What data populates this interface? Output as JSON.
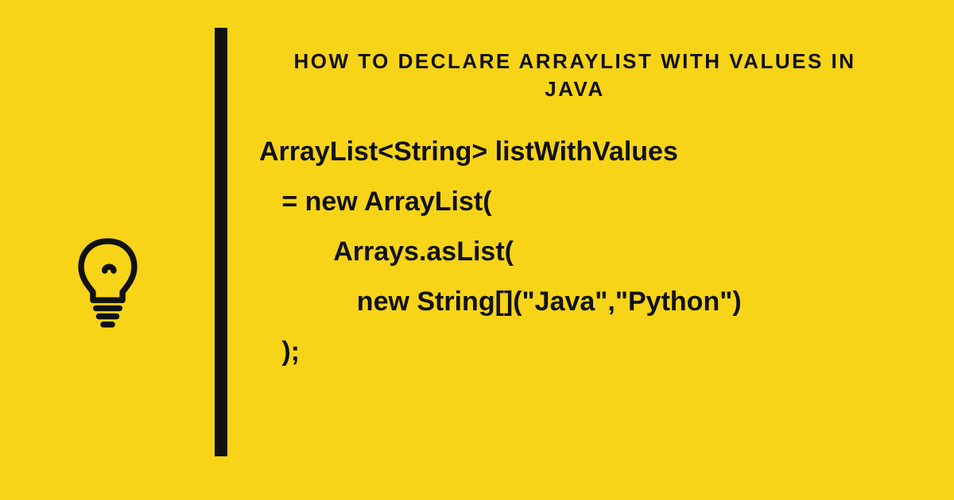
{
  "title": "HOW TO DECLARE ARRAYLIST WITH VALUES IN JAVA",
  "code": {
    "line1": "ArrayList<String> listWithValues",
    "line2": "   = new ArrayList(",
    "line3": "          Arrays.asList(",
    "line4": "             new String[](\"Java\",\"Python\")",
    "line5": "   );"
  },
  "colors": {
    "background": "#f7d417",
    "foreground": "#111"
  }
}
